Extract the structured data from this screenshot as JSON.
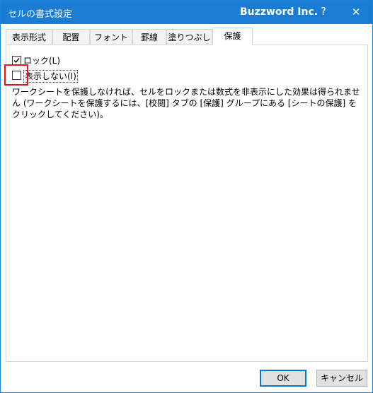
{
  "window": {
    "title": "セルの書式設定",
    "brand": "Buzzword Inc.",
    "help_glyph": "?",
    "close_glyph": "✕",
    "titlebar_color": "#1a7cd2"
  },
  "tabs": [
    {
      "label": "表示形式"
    },
    {
      "label": "配置"
    },
    {
      "label": "フォント"
    },
    {
      "label": "罫線"
    },
    {
      "label": "塗りつぶし"
    },
    {
      "label": "保護",
      "active": true
    }
  ],
  "protection": {
    "lock": {
      "label": "ロック(L)",
      "checked": true
    },
    "hidden": {
      "label": "表示しない(I)",
      "checked": false
    },
    "description": "ワークシートを保護しなければ、セルをロックまたは数式を非表示にした効果は得られません (ワークシートを保護するには、[校閲] タブの [保護] グループにある [シートの保護] をクリックしてください)。"
  },
  "buttons": {
    "ok": "OK",
    "cancel": "キャンセル"
  },
  "accent": {
    "highlight": "#e0171b",
    "default_button_border": "#0078d7"
  }
}
